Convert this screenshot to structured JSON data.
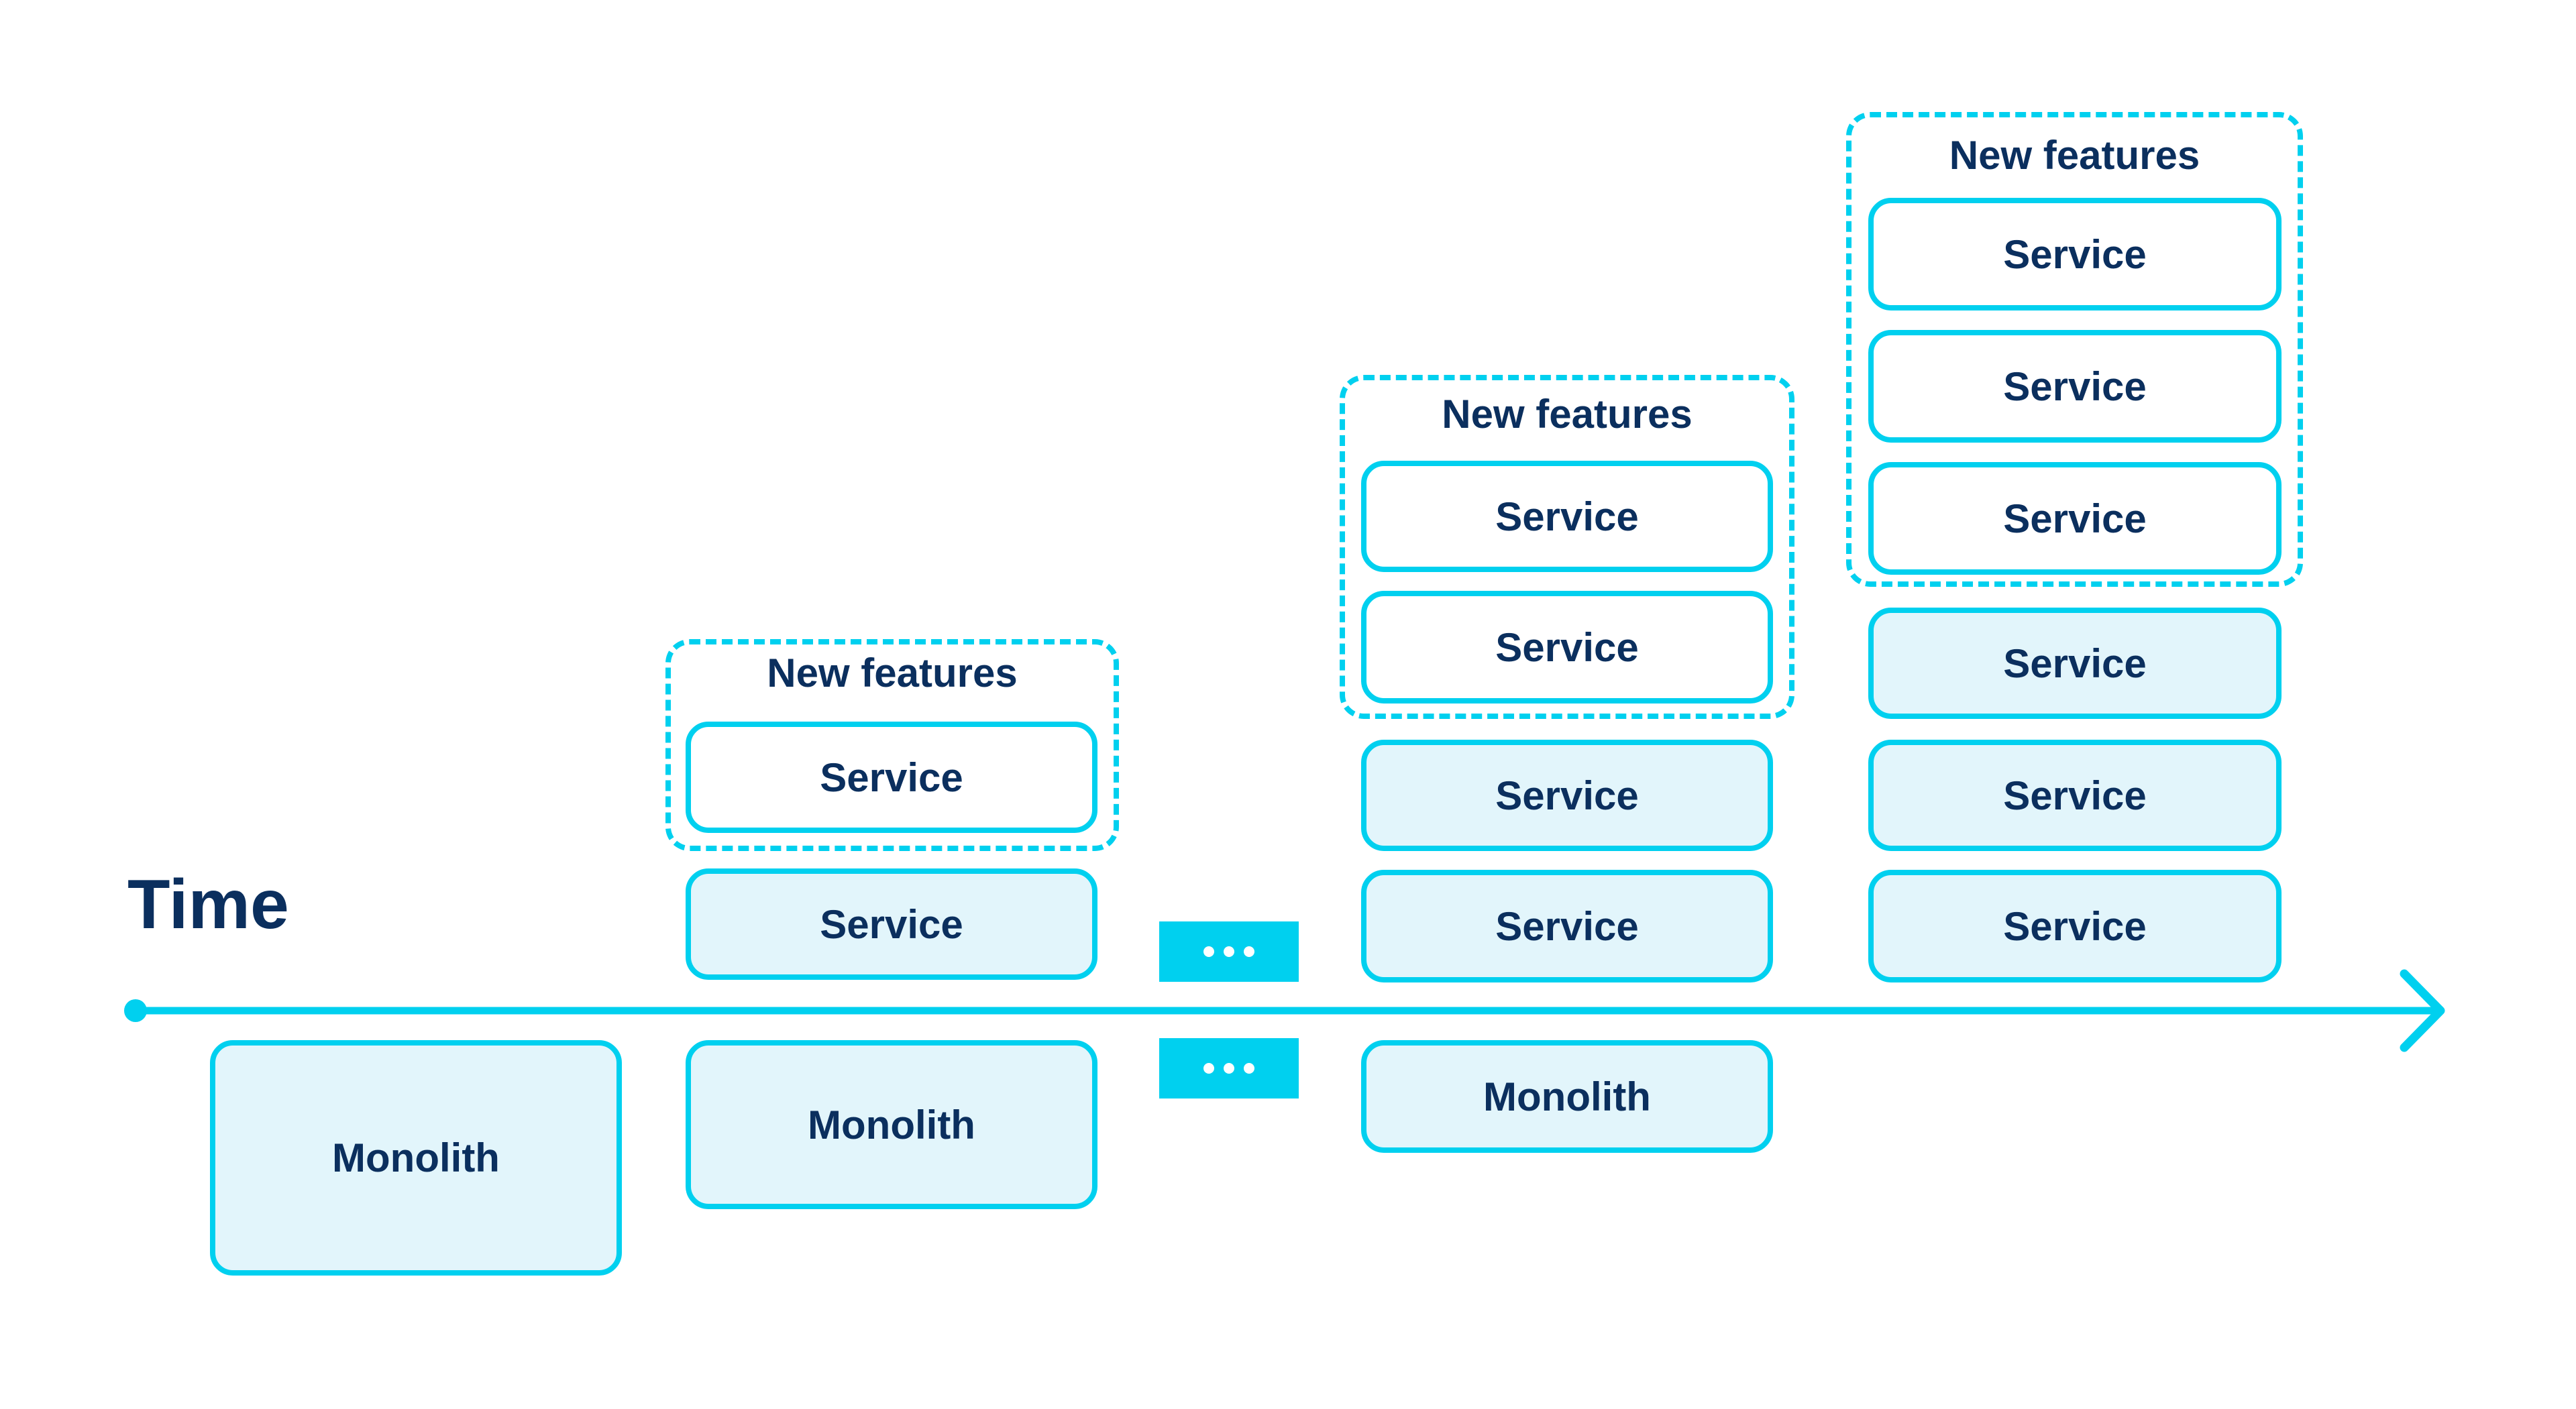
{
  "axis": {
    "label": "Time",
    "color": "#00d0ef"
  },
  "colors": {
    "stroke": "#00d0ef",
    "fill": "#e2f5fb",
    "text": "#0b2f5e"
  },
  "columns": [
    {
      "below_axis": "Monolith",
      "existing_services": [],
      "new_features": null
    },
    {
      "below_axis": "Monolith",
      "existing_services": [
        "Service"
      ],
      "new_features": {
        "title": "New features",
        "services": [
          "Service"
        ]
      }
    },
    {
      "below_axis": "…",
      "ellipsis": true
    },
    {
      "below_axis": "Monolith",
      "existing_services": [
        "Service",
        "Service"
      ],
      "new_features": {
        "title": "New features",
        "services": [
          "Service",
          "Service"
        ]
      }
    },
    {
      "below_axis": null,
      "existing_services": [
        "Service",
        "Service",
        "Service"
      ],
      "new_features": {
        "title": "New features",
        "services": [
          "Service",
          "Service",
          "Service"
        ]
      }
    }
  ]
}
